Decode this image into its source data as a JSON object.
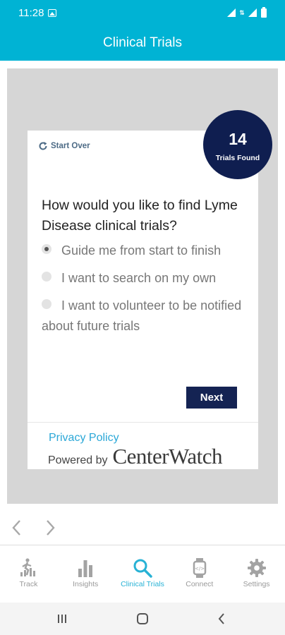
{
  "status_bar": {
    "time": "11:28"
  },
  "app_bar": {
    "title": "Clinical Trials"
  },
  "card": {
    "start_over": "Start Over",
    "question": "How would you like to find Lyme Disease clinical trials?",
    "options": [
      {
        "label": "Guide me from start to finish",
        "selected": true
      },
      {
        "label": "I want to search on my own",
        "selected": false
      },
      {
        "label": "I want to volunteer to be notified about future trials",
        "selected": false
      }
    ],
    "next_label": "Next",
    "privacy_label": "Privacy Policy",
    "powered_by": "Powered by",
    "brand": "CenterWatch"
  },
  "badge": {
    "count": "14",
    "label": "Trials Found"
  },
  "tabs": [
    {
      "label": "Track",
      "icon": "track-icon",
      "active": false
    },
    {
      "label": "Insights",
      "icon": "bar-chart-icon",
      "active": false
    },
    {
      "label": "Clinical Trials",
      "icon": "search-icon",
      "active": true
    },
    {
      "label": "Connect",
      "icon": "watch-icon",
      "active": false
    },
    {
      "label": "Settings",
      "icon": "gear-icon",
      "active": false
    }
  ],
  "colors": {
    "accent": "#00b3d4",
    "badge": "#0f1e50",
    "button": "#142353",
    "link": "#2aa7d7",
    "tab_inactive": "#9a9a9a",
    "tab_active": "#28b2d5"
  }
}
